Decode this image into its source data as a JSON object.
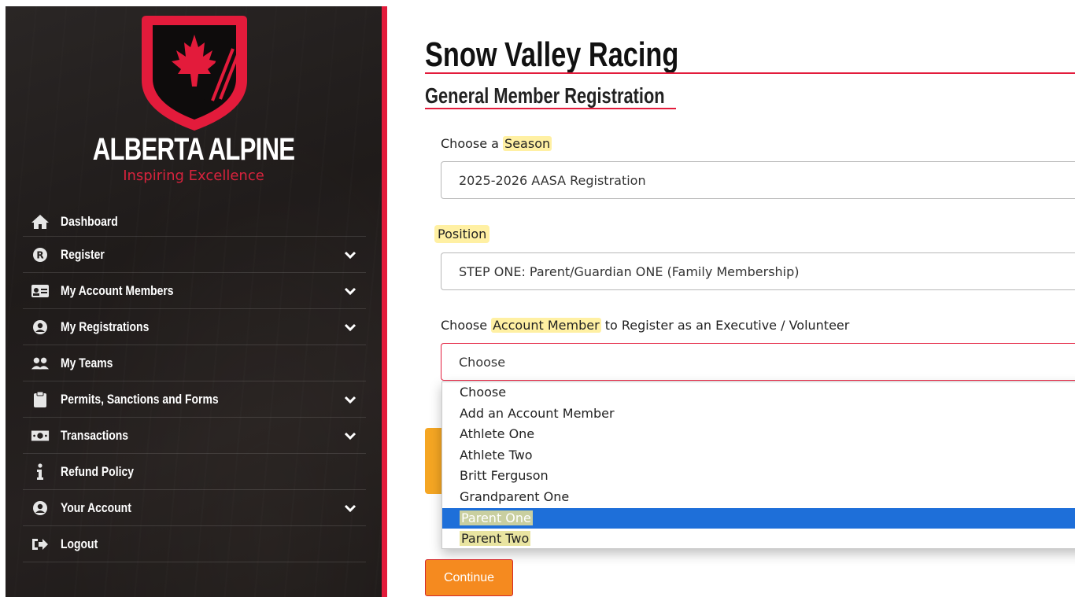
{
  "brand": {
    "name": "ALBERTA ALPINE",
    "tagline": "Inspiring Excellence",
    "colors": {
      "red": "#e31b3b",
      "sidebar": "#231f1e",
      "orange": "#f58a1f"
    }
  },
  "sidebar": {
    "items": [
      {
        "label": "Dashboard",
        "icon": "home-icon",
        "expandable": false
      },
      {
        "label": "Register",
        "icon": "register-r-icon",
        "expandable": true
      },
      {
        "label": "My Account Members",
        "icon": "id-card-icon",
        "expandable": true
      },
      {
        "label": "My Registrations",
        "icon": "user-circle-icon",
        "expandable": true
      },
      {
        "label": "My Teams",
        "icon": "users-icon",
        "expandable": false
      },
      {
        "label": "Permits, Sanctions and Forms",
        "icon": "clipboard-icon",
        "expandable": true
      },
      {
        "label": "Transactions",
        "icon": "money-icon",
        "expandable": true
      },
      {
        "label": "Refund Policy",
        "icon": "info-icon",
        "expandable": false
      },
      {
        "label": "Your Account",
        "icon": "user-circle-icon",
        "expandable": true
      },
      {
        "label": "Logout",
        "icon": "logout-icon",
        "expandable": false
      }
    ]
  },
  "main": {
    "title": "Snow Valley Racing",
    "subtitle": "General Member Registration",
    "season": {
      "label_prefix": "Choose a ",
      "label_highlight": "Season",
      "value": "2025-2026 AASA Registration"
    },
    "position": {
      "label": "Position",
      "value": "STEP ONE: Parent/Guardian ONE (Family Membership)"
    },
    "account_member": {
      "label_prefix": "Choose ",
      "label_highlight": "Account Member",
      "label_suffix": " to Register as an Executive / Volunteer",
      "value": "Choose",
      "options": [
        "Choose",
        "Add an Account Member",
        "Athlete One",
        "Athlete Two",
        "Britt Ferguson",
        "Grandparent One",
        "Parent One",
        "Parent Two"
      ],
      "selected_option": "Parent One"
    },
    "continue_label": "Continue"
  }
}
